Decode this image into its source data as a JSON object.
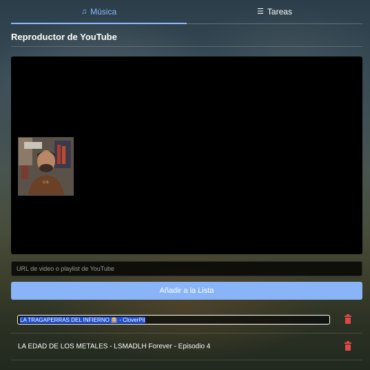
{
  "tabs": [
    {
      "label": "Música",
      "icon": "music-note-icon",
      "active": true
    },
    {
      "label": "Tareas",
      "icon": "task-list-icon",
      "active": false
    }
  ],
  "section_title": "Reproductor de YouTube",
  "url_input": {
    "placeholder": "URL de video o playlist de YouTube",
    "value": ""
  },
  "add_button_label": "Añadir a la Lista",
  "playlist": [
    {
      "title": "LA TRAGAPERRAS DEL INFIERNO 🎰 - CloverPit",
      "editing": true
    },
    {
      "title": "LA EDAD DE LOS METALES - LSMADLH Forever - Episodio 4",
      "editing": false
    }
  ],
  "colors": {
    "accent": "#8ab4f8",
    "delete": "#e04848",
    "player_bg": "#000000"
  }
}
